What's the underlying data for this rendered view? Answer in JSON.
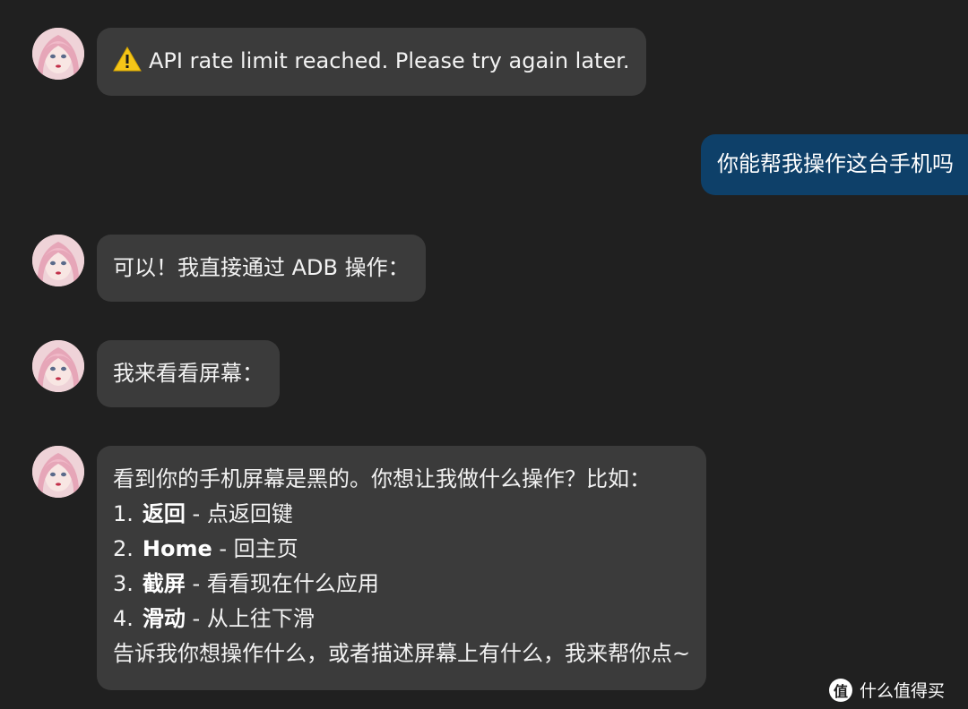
{
  "messages": [
    {
      "role": "assistant",
      "text": "API rate limit reached. Please try again later.",
      "icon": "warning-icon"
    },
    {
      "role": "user",
      "text": "你能帮我操作这台手机吗"
    },
    {
      "role": "assistant",
      "text": "可以！我直接通过 ADB 操作："
    },
    {
      "role": "assistant",
      "text": "我来看看屏幕："
    },
    {
      "role": "assistant",
      "intro": "看到你的手机屏幕是黑的。你想让我做什么操作？比如：",
      "items": [
        {
          "num": "1.",
          "bold": "返回",
          "rest": " - 点返回键"
        },
        {
          "num": "2.",
          "bold": "Home",
          "rest": " - 回主页"
        },
        {
          "num": "3.",
          "bold": "截屏",
          "rest": " - 看看现在什么应用"
        },
        {
          "num": "4.",
          "bold": "滑动",
          "rest": " - 从上往下滑"
        }
      ],
      "outro": "告诉我你想操作什么，或者描述屏幕上有什么，我来帮你点~"
    }
  ],
  "watermark": {
    "logo": "值",
    "text": "什么值得买"
  },
  "colors": {
    "background": "#202020",
    "assistant_bubble": "#3b3b3b",
    "user_bubble": "#0e4069",
    "warning": "#f5c518"
  }
}
